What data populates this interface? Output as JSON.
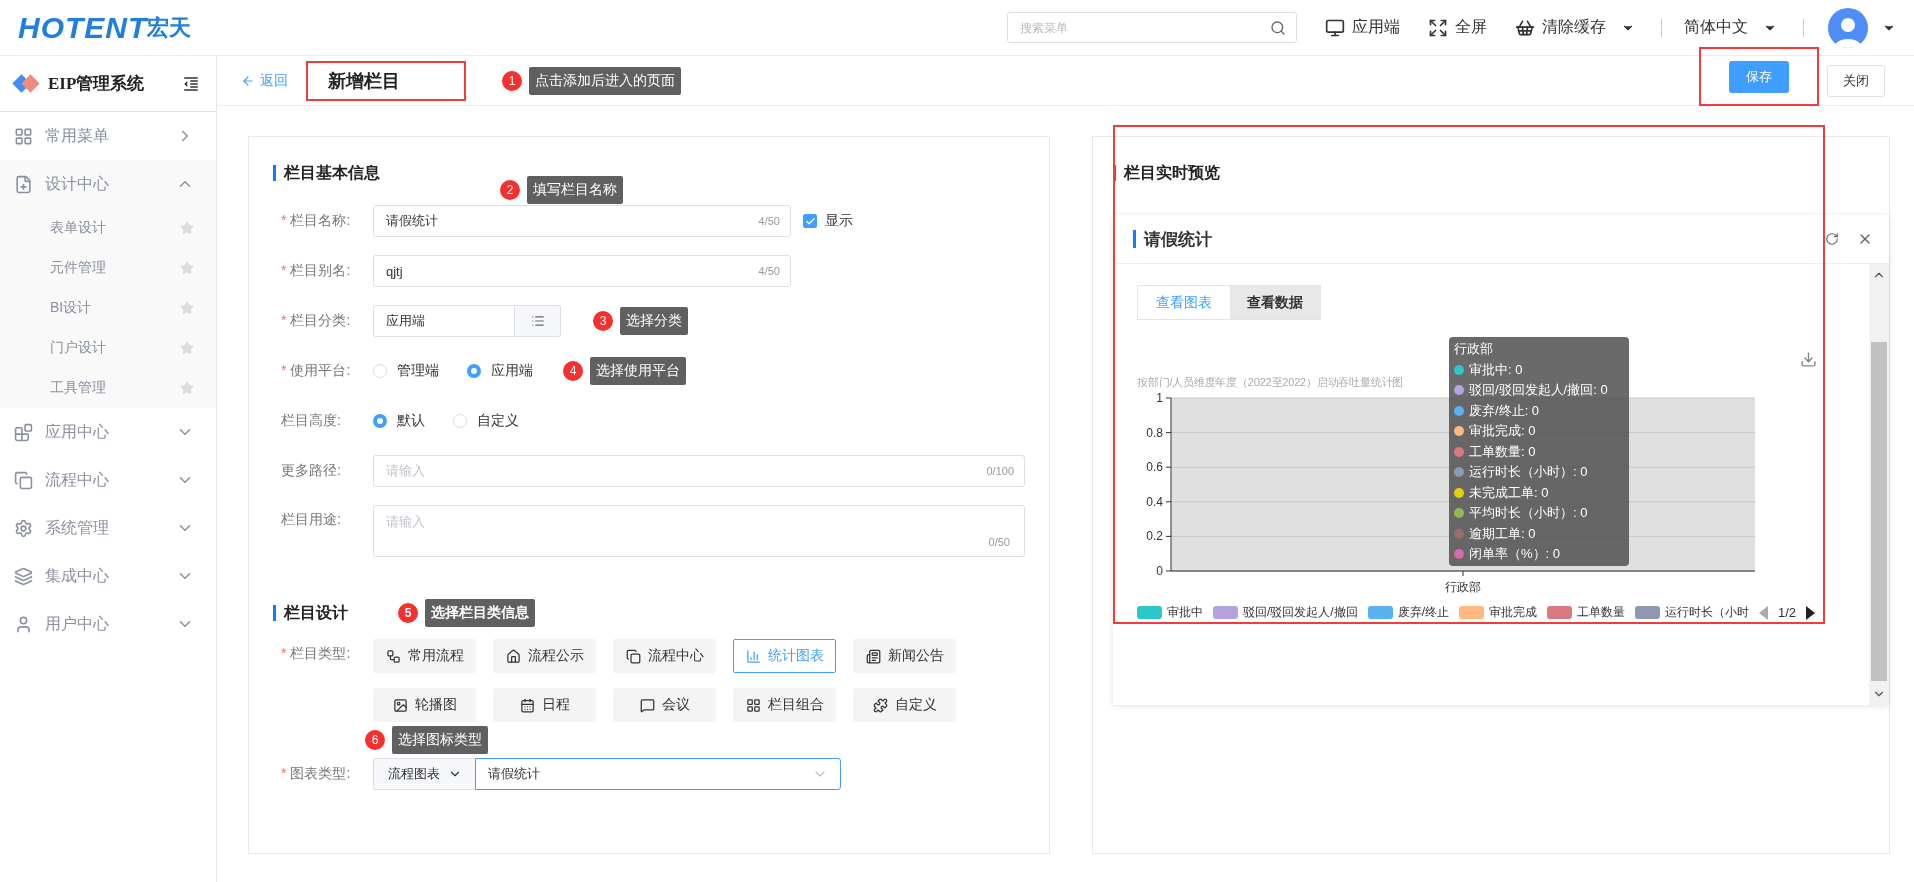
{
  "header": {
    "brand": "HOTENT",
    "brand_cn": "宏天",
    "search": {
      "placeholder": "搜索菜单"
    },
    "actions": [
      {
        "label": "应用端",
        "dropdown": false
      },
      {
        "label": "全屏",
        "dropdown": false
      },
      {
        "label": "清除缓存",
        "dropdown": true
      }
    ],
    "language": "简体中文"
  },
  "sidebar": {
    "title": "EIP管理系统",
    "items": [
      {
        "label": "常用菜单",
        "kind": "link"
      },
      {
        "label": "设计中心",
        "kind": "group",
        "expanded": true,
        "children": [
          {
            "label": "表单设计"
          },
          {
            "label": "元件管理"
          },
          {
            "label": "BI设计"
          },
          {
            "label": "门户设计"
          },
          {
            "label": "工具管理"
          }
        ]
      },
      {
        "label": "应用中心",
        "kind": "group",
        "expanded": false
      },
      {
        "label": "流程中心",
        "kind": "group",
        "expanded": false
      },
      {
        "label": "系统管理",
        "kind": "group",
        "expanded": false
      },
      {
        "label": "集成中心",
        "kind": "group",
        "expanded": false
      },
      {
        "label": "用户中心",
        "kind": "group",
        "expanded": false
      }
    ]
  },
  "page": {
    "back": "返回",
    "title": "新增栏目",
    "save": "保存",
    "close": "关闭"
  },
  "annotations": [
    {
      "number": "1",
      "text": "点击添加后进入的页面"
    },
    {
      "number": "2",
      "text": "填写栏目名称"
    },
    {
      "number": "3",
      "text": "选择分类"
    },
    {
      "number": "4",
      "text": "选择使用平台"
    },
    {
      "number": "5",
      "text": "选择栏目类信息"
    },
    {
      "number": "6",
      "text": "选择图标类型"
    }
  ],
  "basic": {
    "title": "栏目基本信息",
    "fields": [
      {
        "kind": "input",
        "mark": "*",
        "label": "栏目名称:",
        "value": "请假统计",
        "count": "4/50",
        "checkbox": {
          "label": "显示",
          "checked": true
        }
      },
      {
        "kind": "input",
        "mark": "*",
        "label": "栏目别名:",
        "value": "qjtj",
        "count": "4/50"
      },
      {
        "kind": "picker",
        "mark": "*",
        "label": "栏目分类:",
        "value": "应用端"
      },
      {
        "kind": "radio",
        "mark": "*",
        "label": "使用平台:",
        "options": [
          {
            "label": "管理端",
            "selected": false
          },
          {
            "label": "应用端",
            "selected": true
          }
        ]
      },
      {
        "kind": "radio",
        "label": "栏目高度:",
        "options": [
          {
            "label": "默认",
            "selected": true
          },
          {
            "label": "自定义",
            "selected": false
          }
        ]
      },
      {
        "kind": "wide-input",
        "label": "更多路径:",
        "placeholder": "请输入",
        "count": "0/100"
      },
      {
        "kind": "textarea",
        "label": "栏目用途:",
        "placeholder": "请输入",
        "count": "0/50"
      }
    ]
  },
  "design": {
    "title": "栏目设计",
    "type_mark": "*",
    "type_label": "栏目类型:",
    "types": [
      {
        "label": "常用流程",
        "selected": false
      },
      {
        "label": "流程公示",
        "selected": false
      },
      {
        "label": "流程中心",
        "selected": false
      },
      {
        "label": "统计图表",
        "selected": true
      },
      {
        "label": "新闻公告",
        "selected": false
      },
      {
        "label": "轮播图",
        "selected": false
      },
      {
        "label": "日程",
        "selected": false
      },
      {
        "label": "会议",
        "selected": false
      },
      {
        "label": "栏目组合",
        "selected": false
      },
      {
        "label": "自定义",
        "selected": false
      }
    ],
    "chart_mark": "*",
    "chart_label": "图表类型:",
    "chart_category": "流程图表",
    "chart_value": "请假统计"
  },
  "preview": {
    "title": "栏目实时预览",
    "widget_title": "请假统计",
    "tabs": [
      {
        "label": "查看图表",
        "selected": true
      },
      {
        "label": "查看数据",
        "selected": false
      }
    ],
    "chart_data": {
      "type": "bar",
      "title": "按部门/人员维度年度（2022至2022）启动吞吐量统计图",
      "categories": [
        "行政部"
      ],
      "ylim": [
        0,
        1
      ],
      "yticks": [
        0,
        0.2,
        0.4,
        0.6,
        0.8,
        1
      ],
      "grid": true,
      "series": [
        {
          "name": "审批中",
          "color": "#2ec7c9",
          "values": [
            0
          ]
        },
        {
          "name": "驳回/驳回发起人/撤回",
          "color": "#b6a2de",
          "values": [
            0
          ]
        },
        {
          "name": "废弃/终止",
          "color": "#5ab1ef",
          "values": [
            0
          ]
        },
        {
          "name": "审批完成",
          "color": "#ffb980",
          "values": [
            0
          ]
        },
        {
          "name": "工单数量",
          "color": "#d87a80",
          "values": [
            0
          ]
        },
        {
          "name": "运行时长（小时）",
          "color": "#8d98b3",
          "values": [
            0
          ]
        },
        {
          "name": "未完成工单",
          "color": "#e5cf0d",
          "values": [
            0
          ]
        },
        {
          "name": "平均时长（小时）",
          "color": "#97b552",
          "values": [
            0
          ]
        },
        {
          "name": "逾期工单",
          "color": "#95706d",
          "values": [
            0
          ]
        },
        {
          "name": "闭单率（%）",
          "color": "#dc69aa",
          "values": [
            0
          ]
        }
      ]
    },
    "tooltip": {
      "title": "行政部",
      "readings": [
        ": 0",
        ": 0",
        ": 0",
        ": 0",
        ": 0",
        ": 0",
        ": 0",
        ": 0",
        ": 0",
        ": 0"
      ]
    },
    "legend": [
      {
        "label": "审批中"
      },
      {
        "label": "驳回/驳回发起人/撤回"
      },
      {
        "label": "废弃/终止"
      },
      {
        "label": "审批完成"
      },
      {
        "label": "工单数量"
      },
      {
        "label": "运行时长（小时"
      }
    ],
    "legend_page": "1/2"
  }
}
